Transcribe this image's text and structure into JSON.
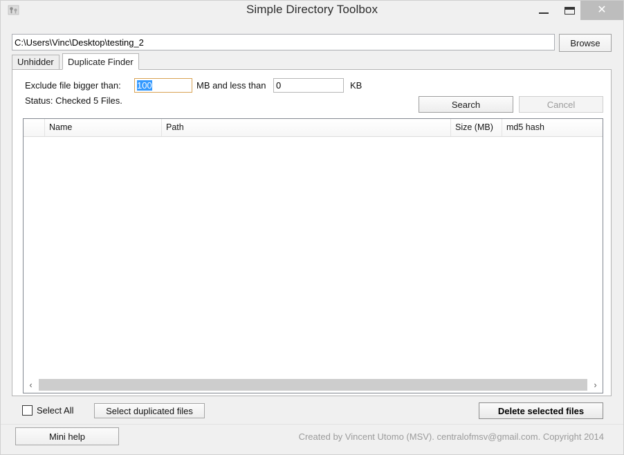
{
  "window": {
    "title": "Simple Directory Toolbox",
    "app_icon": "app-icon",
    "controls": {
      "minimize": "minimize-icon",
      "maximize": "maximize-icon",
      "close": "✕"
    }
  },
  "path_bar": {
    "value": "C:\\Users\\Vinc\\Desktop\\testing_2",
    "placeholder": "",
    "browse_label": "Browse"
  },
  "tabs": [
    {
      "label": "Unhidder",
      "active": false
    },
    {
      "label": "Duplicate Finder",
      "active": true
    }
  ],
  "filter": {
    "label": "Exclude file bigger than:",
    "mb_value": "100",
    "mb_unit": "MB and less than",
    "kb_value": "0",
    "kb_unit": "KB"
  },
  "status": {
    "text": "Status: Checked 5 Files."
  },
  "actions": {
    "search_label": "Search",
    "cancel_label": "Cancel",
    "cancel_enabled": false
  },
  "list": {
    "columns": [
      "",
      "Name",
      "Path",
      "Size (MB)",
      "md5 hash"
    ],
    "rows": [],
    "scrollbar": {
      "left_arrow": "‹",
      "right_arrow": "›"
    }
  },
  "bottom": {
    "select_all_label": "Select All",
    "select_all_checked": false,
    "select_duplicated_label": "Select duplicated files",
    "delete_label": "Delete selected files"
  },
  "footer": {
    "mini_help_label": "Mini help",
    "credit": "Created by Vincent Utomo (MSV). centralofmsv@gmail.com. Copyright 2014"
  },
  "colors": {
    "selection": "#3399ff",
    "focus_border": "#d8a253",
    "close_hover": "#bdbdbd",
    "disabled_text": "#9a9a9a",
    "credit_text": "#9b9b9b"
  }
}
